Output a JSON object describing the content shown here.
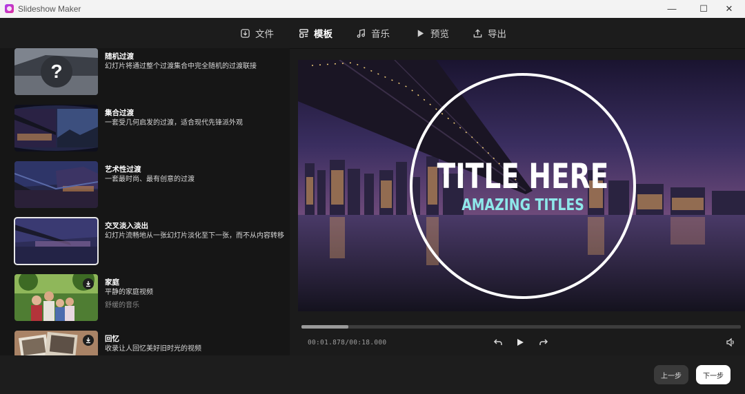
{
  "window": {
    "title": "Slideshow Maker",
    "min_glyph": "—",
    "max_glyph": "☐",
    "close_glyph": "✕"
  },
  "nav": {
    "tabs": [
      {
        "label": "文件",
        "icon": "file-import-icon"
      },
      {
        "label": "模板",
        "icon": "template-icon",
        "active": true
      },
      {
        "label": "音乐",
        "icon": "music-icon"
      },
      {
        "label": "预览",
        "icon": "play-icon"
      },
      {
        "label": "导出",
        "icon": "export-icon"
      }
    ]
  },
  "templates": [
    {
      "title": "随机过渡",
      "desc": "幻灯片将通过整个过渡集合中完全随机的过渡联接",
      "icon": "question-icon"
    },
    {
      "title": "集合过渡",
      "desc": "一套受几何启发的过渡，适合现代先锋派外观"
    },
    {
      "title": "艺术性过渡",
      "desc": "一套最时尚、最有创意的过渡"
    },
    {
      "title": "交叉淡入淡出",
      "desc": "幻灯片流畅地从一张幻灯片淡化至下一张，而不从内容转移",
      "selected": true
    },
    {
      "title": "家庭",
      "desc": "平静的家庭视频",
      "sub": "舒缓的音乐",
      "icon": "download-icon"
    },
    {
      "title": "回忆",
      "desc": "收录让人回忆美好旧时光的视频",
      "icon": "download-icon"
    }
  ],
  "preview": {
    "title_text": "TITLE HERE",
    "subtitle_text": "AMAZING TITLES",
    "accent_color": "#8ee8ea"
  },
  "player": {
    "time_current": "00:01.878",
    "time_total": "00:18.000",
    "separator": "/",
    "progress": 0.107
  },
  "footer": {
    "prev_label": "上一步",
    "next_label": "下一步"
  }
}
